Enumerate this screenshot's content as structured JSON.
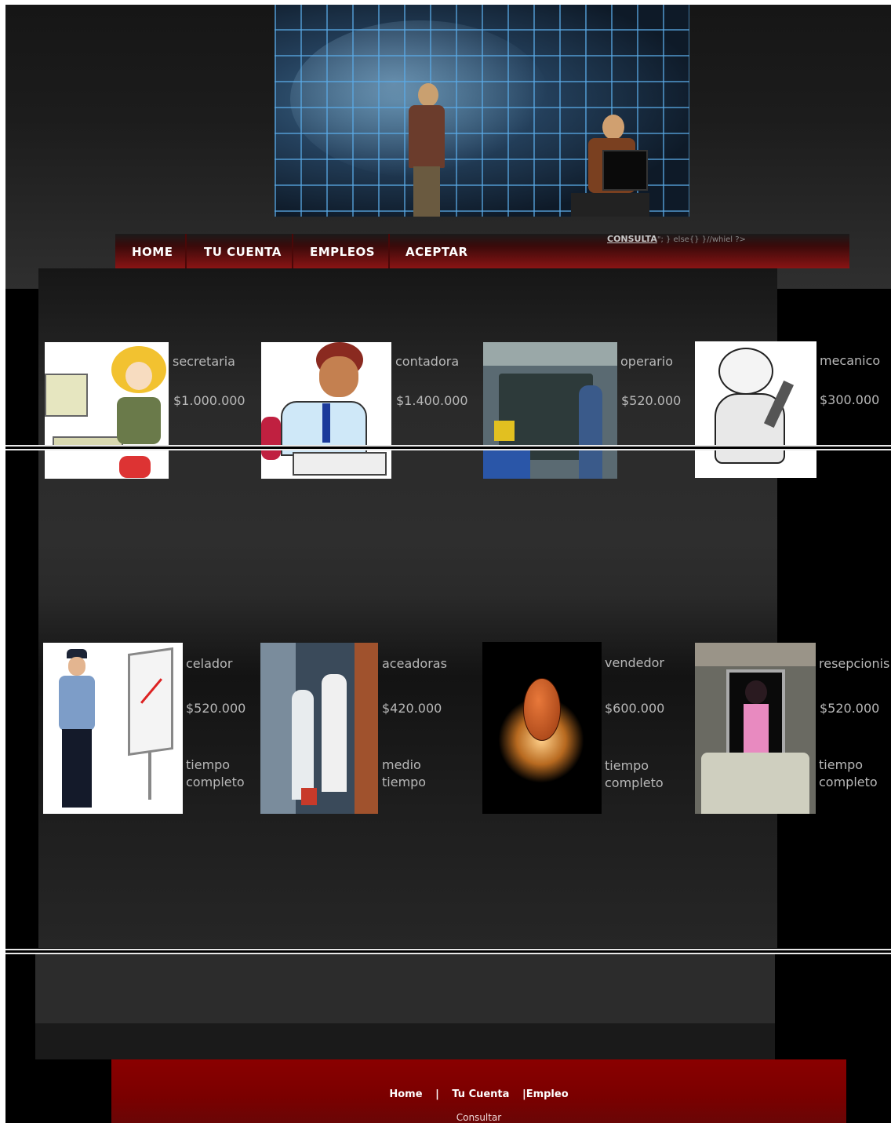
{
  "nav": {
    "items": [
      "HOME",
      "TU CUENTA",
      "EMPLEOS",
      "ACEPTAR"
    ],
    "consulta_label": "CONSULTA",
    "consulta_code": "\"; } else{} }//whiel ?>"
  },
  "jobs": [
    {
      "title": "secretaria",
      "salary": "$1.000.000",
      "schedule": "",
      "image": "secretary-clipart"
    },
    {
      "title": "contadora",
      "salary": "$1.400.000",
      "schedule": "",
      "image": "accountant-clipart"
    },
    {
      "title": "operario",
      "salary": "$520.000",
      "schedule": "",
      "image": "factory-worker-photo"
    },
    {
      "title": "mecanico",
      "salary": "$300.000",
      "schedule": "",
      "image": "mechanic-sketch"
    },
    {
      "title": "celador",
      "salary": "$520.000",
      "schedule": "tiempo completo",
      "image": "security-guard-photo"
    },
    {
      "title": "aceadoras",
      "salary": "$420.000",
      "schedule": "medio tiempo",
      "image": "cleaners-photo"
    },
    {
      "title": "vendedor",
      "salary": "$600.000",
      "schedule": "tiempo completo",
      "image": "basketball-photo"
    },
    {
      "title": "resepcionis",
      "salary": "$520.000",
      "schedule": "tiempo completo",
      "image": "receptionist-clipart"
    }
  ],
  "footer": {
    "links": [
      "Home",
      "Tu Cuenta",
      "Empleo"
    ],
    "separators": [
      "|",
      "|"
    ],
    "consultar": "Consultar"
  }
}
